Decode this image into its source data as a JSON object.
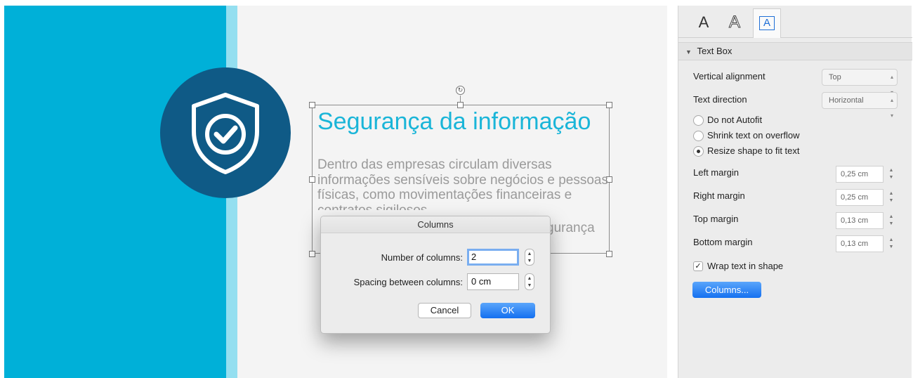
{
  "slide": {
    "title": "Segurança da informação",
    "body": "Dentro das empresas circulam diversas informações sensíveis sobre negócios e pessoas físicas, como movimentações financeiras e contratos sigilosos.",
    "tail": "gurança",
    "colors": {
      "band": "#00b0d8",
      "band_light": "#94dff0",
      "circle": "#0f5a86",
      "title": "#1ab5d8",
      "body": "#9a9a9a"
    },
    "icon": "shield-check-icon"
  },
  "dialog": {
    "title": "Columns",
    "num_columns_label": "Number of columns:",
    "num_columns_value": "2",
    "spacing_label": "Spacing between columns:",
    "spacing_value": "0 cm",
    "cancel_label": "Cancel",
    "ok_label": "OK"
  },
  "inspector": {
    "tabs": [
      {
        "glyph": "A",
        "icon": "text-style-icon"
      },
      {
        "glyph": "A",
        "icon": "text-outline-icon"
      },
      {
        "glyph": "A",
        "icon": "text-box-icon",
        "active": true
      }
    ],
    "section_title": "Text Box",
    "vertical_alignment": {
      "label": "Vertical alignment",
      "value": "Top"
    },
    "text_direction": {
      "label": "Text direction",
      "value": "Horizontal"
    },
    "autofit": {
      "options": [
        "Do not Autofit",
        "Shrink text on overflow",
        "Resize shape to fit text"
      ],
      "selected": 2
    },
    "margins": [
      {
        "label": "Left margin",
        "value": "0,25 cm"
      },
      {
        "label": "Right margin",
        "value": "0,25 cm"
      },
      {
        "label": "Top margin",
        "value": "0,13 cm"
      },
      {
        "label": "Bottom margin",
        "value": "0,13 cm"
      }
    ],
    "wrap": {
      "label": "Wrap text in shape",
      "checked": true,
      "mark": "✓"
    },
    "columns_button": "Columns..."
  }
}
